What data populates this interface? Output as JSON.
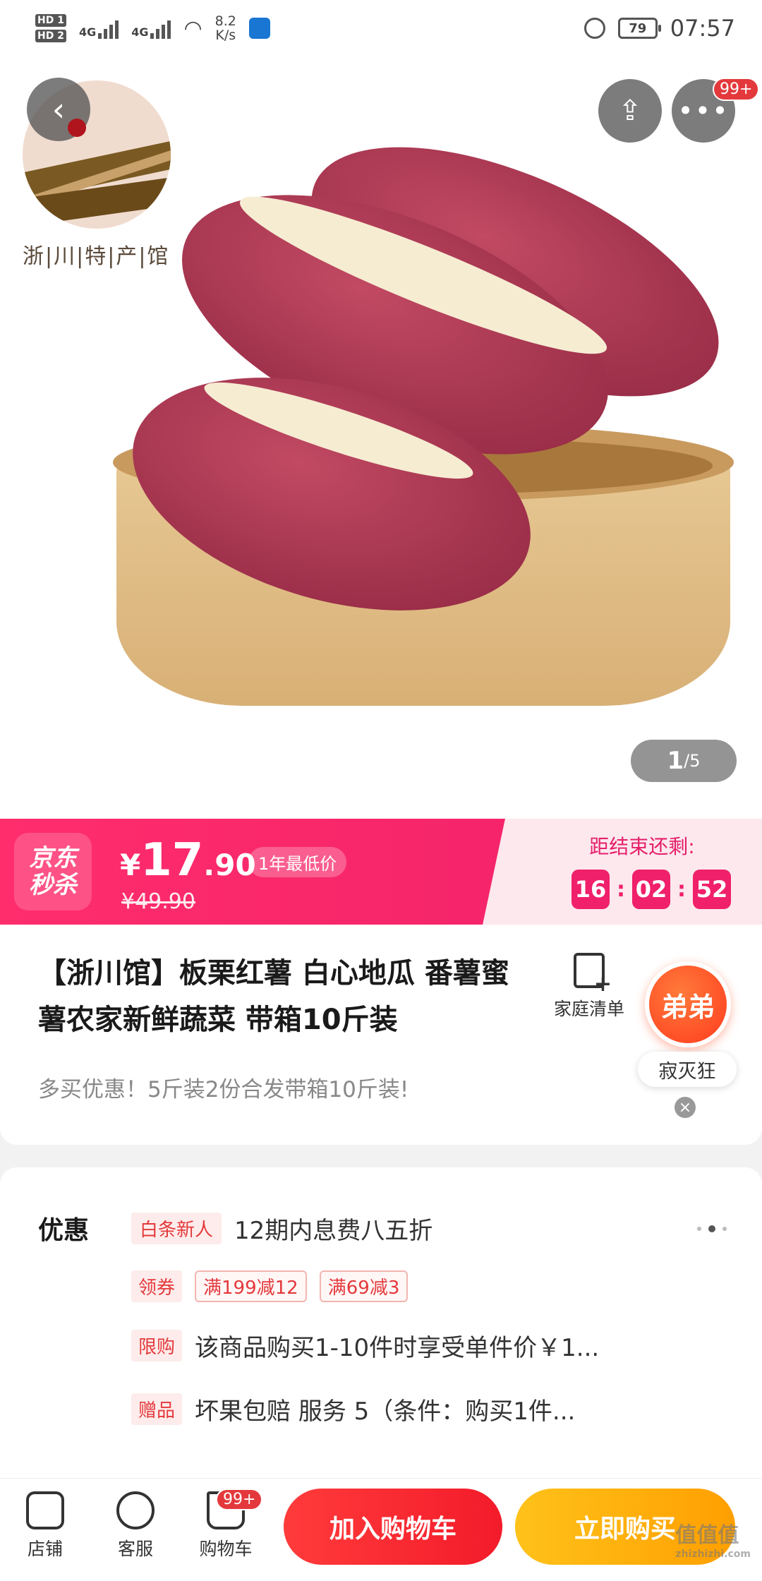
{
  "status_bar": {
    "hd1": "HD 1",
    "hd2": "HD 2",
    "net1": "4G",
    "net2": "4G",
    "speed_value": "8.2",
    "speed_unit": "K/s",
    "battery": "79",
    "time": "07:57"
  },
  "top_actions": {
    "back_icon": "chevron-left-icon",
    "more_badge": "99+"
  },
  "hero": {
    "brand_name": "浙|川|特|产|馆",
    "page_current": "1",
    "page_total": "/5"
  },
  "flash_sale": {
    "logo_line1": "京东",
    "logo_line2": "秒杀",
    "currency": "¥",
    "price_int": "17",
    "price_dec": ".90",
    "original_price": "¥49.90",
    "low_price_tag": "1年最低价",
    "ends_label": "距结束还剩:",
    "countdown": {
      "h": "16",
      "m": "02",
      "s": "52",
      "sep": ":"
    },
    "accent_color": "#f0206a"
  },
  "product": {
    "title": "【浙川馆】板栗红薯 白心地瓜 番薯蜜薯农家新鲜蔬菜 带箱10斤装",
    "family_list_label": "家庭清单",
    "subtitle": "多买优惠！5斤装2份合发带箱10斤装!"
  },
  "floating": {
    "bubble_label": "弟弟",
    "name_label": "寂灭狂",
    "close": "×"
  },
  "promotions": {
    "heading": "优惠",
    "rows": [
      {
        "tag": "白条新人",
        "text": "12期内息费八五折"
      },
      {
        "tag": "领券",
        "coupons": [
          "满199减12",
          "满69减3"
        ]
      },
      {
        "tag": "限购",
        "text": "该商品购买1-10件时享受单件价￥1..."
      },
      {
        "tag": "赠品",
        "text": "坏果包赔 服务 5（条件：购买1件..."
      }
    ]
  },
  "bottom_bar": {
    "store_label": "店铺",
    "service_label": "客服",
    "cart_label": "购物车",
    "cart_badge": "99+",
    "add_to_cart": "加入购物车",
    "buy_now": "立即购买"
  },
  "watermark": {
    "main": "值值值",
    "sub": "zhizhizhi.com"
  }
}
